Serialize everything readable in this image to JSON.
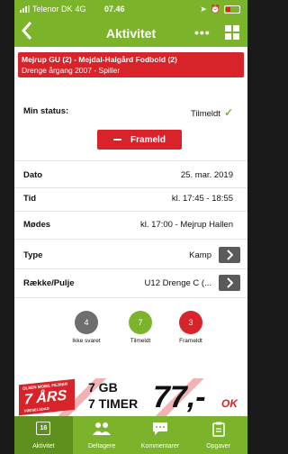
{
  "status_bar": {
    "carrier": "Telenor DK",
    "network": "4G",
    "time": "07.46"
  },
  "nav": {
    "title": "Aktivitet",
    "back_icon": "chevron-left-icon",
    "more_icon": "more-dots-icon",
    "grid_icon": "grid-icon"
  },
  "banner": {
    "line1": "Mejrup GU (2) - Mejdal-Halgård Fodbold (2)",
    "line2": "Drenge årgang 2007 - Spiller"
  },
  "status": {
    "label": "Min status:",
    "value": "Tilmeldt",
    "check": "✓"
  },
  "frameld_button": {
    "label": "Frameld"
  },
  "details": [
    {
      "label": "Dato",
      "value": "25. mar. 2019"
    },
    {
      "label": "Tid",
      "value": "kl. 17:45 - 18:55"
    },
    {
      "label": "Mødes",
      "value": "kl. 17:00 - Mejrup Hallen"
    },
    {
      "label": "Type",
      "value": "Kamp"
    },
    {
      "label": "Række/Pulje",
      "value": "U12 Drenge C (..."
    }
  ],
  "counts": [
    {
      "count": "4",
      "label": "Ikke svaret",
      "color": "#6e6e6e"
    },
    {
      "count": "7",
      "label": "Tilmeldt",
      "color": "#7bb32a"
    },
    {
      "count": "3",
      "label": "Frameldt",
      "color": "#d8232a"
    }
  ],
  "ad": {
    "badge_top": "OLSEN MOBIL FEJRER",
    "badge_main": "7 ÅRS",
    "badge_bottom": "FØDSELSDAG",
    "line1": "7 GB",
    "line2": "7 TIMER",
    "price": "77,-",
    "suffix": "OK"
  },
  "tabs": [
    {
      "label": "Aktivitet",
      "icon": "calendar-icon",
      "icon_text": "16"
    },
    {
      "label": "Deltagere",
      "icon": "people-icon"
    },
    {
      "label": "Kommentarer",
      "icon": "chat-icon"
    },
    {
      "label": "Opgaver",
      "icon": "clipboard-icon"
    }
  ],
  "colors": {
    "accent": "#7bb32a",
    "red": "#d8232a",
    "dark_button": "#5a5a5a"
  }
}
